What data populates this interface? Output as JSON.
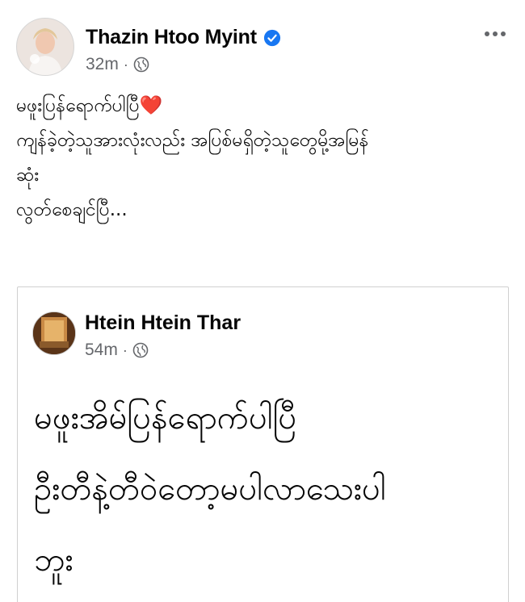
{
  "post": {
    "author": "Thazin Htoo Myint",
    "time": "32m",
    "separator": "·",
    "verified": true,
    "body_lines": [
      "မဖူးပြန်ရောက်ပါပြီ❤️",
      "ကျန်ခဲ့တဲ့သူအားလုံးလည်း အပြစ်မရှိတဲ့သူတွေမို့အမြန်",
      "ဆုံး",
      "လွတ်စေချင်ပြီ..."
    ]
  },
  "shared_post": {
    "author": "Htein Htein Thar",
    "time": "54m",
    "separator": "·",
    "body_lines": [
      "မဖူးအိမ်ပြန်ရောက်ပါပြီ",
      "ဦးတီနဲ့တီဝဲတော့မပါလာသေးပါ",
      "ဘူး"
    ]
  },
  "icons": {
    "verified": "verified-badge-icon",
    "audience": "globe-icon",
    "more": "more-options-icon"
  },
  "colors": {
    "verified_blue": "#1877f2",
    "meta_gray": "#65676b",
    "text": "#050505",
    "heart": "#e0245e"
  }
}
